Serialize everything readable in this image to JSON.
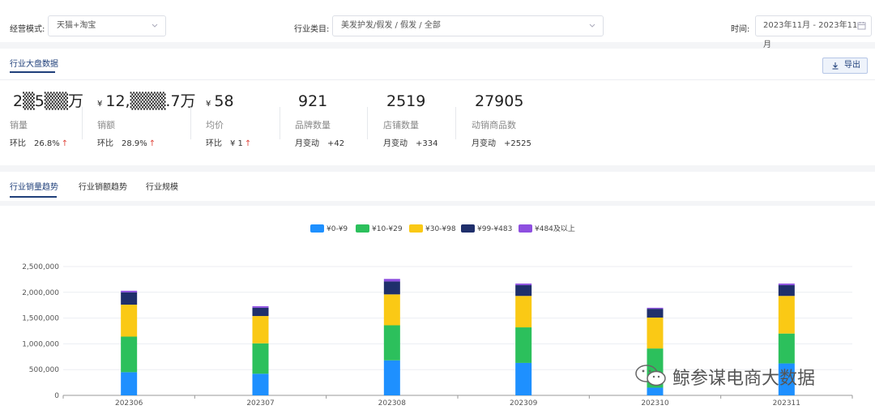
{
  "filters": {
    "mode_label": "经营模式:",
    "mode_value": "天猫+淘宝",
    "category_label": "行业类目:",
    "category_value": "美发护发/假发 / 假发 / 全部",
    "time_label": "时间:",
    "time_value": "2023年11月 - 2023年11月"
  },
  "overview": {
    "tab_label": "行业大盘数据",
    "export_label": "导出",
    "metrics": [
      {
        "currency": "",
        "value": "2▒5▒▒万",
        "label": "销量",
        "change_label": "环比",
        "change_value": "26.8%",
        "arrow": "↑"
      },
      {
        "currency": "¥",
        "value": "12,▒▒▒.7万",
        "label": "销额",
        "change_label": "环比",
        "change_value": "28.9%",
        "arrow": "↑"
      },
      {
        "currency": "¥",
        "value": "58",
        "label": "均价",
        "change_label": "环比",
        "change_value": "¥ 1",
        "arrow": "↑"
      },
      {
        "currency": "",
        "value": "921",
        "label": "品牌数量",
        "change_label": "月变动",
        "change_value": "+42",
        "arrow": ""
      },
      {
        "currency": "",
        "value": "2519",
        "label": "店铺数量",
        "change_label": "月变动",
        "change_value": "+334",
        "arrow": ""
      },
      {
        "currency": "",
        "value": "27905",
        "label": "动销商品数",
        "change_label": "月变动",
        "change_value": "+2525",
        "arrow": ""
      }
    ]
  },
  "trend_tabs": [
    "行业销量趋势",
    "行业销额趋势",
    "行业规模"
  ],
  "chart_data": {
    "type": "bar",
    "stacked": true,
    "categories": [
      "202306",
      "202307",
      "202308",
      "202309",
      "202310",
      "202311"
    ],
    "series": [
      {
        "name": "¥0-¥9",
        "color": "#1e90ff",
        "values": [
          450000,
          420000,
          680000,
          630000,
          150000,
          620000
        ]
      },
      {
        "name": "¥10-¥29",
        "color": "#2cc05c",
        "values": [
          690000,
          590000,
          680000,
          690000,
          760000,
          580000
        ]
      },
      {
        "name": "¥30-¥98",
        "color": "#fac915",
        "values": [
          620000,
          530000,
          600000,
          610000,
          600000,
          730000
        ]
      },
      {
        "name": "¥99-¥483",
        "color": "#1f2f6b",
        "values": [
          240000,
          160000,
          250000,
          210000,
          170000,
          210000
        ]
      },
      {
        "name": "¥484及以上",
        "color": "#8e4fe0",
        "values": [
          30000,
          30000,
          50000,
          30000,
          20000,
          30000
        ]
      }
    ],
    "ylim": [
      0,
      2500000
    ],
    "yticks": [
      0,
      500000,
      1000000,
      1500000,
      2000000,
      2500000
    ],
    "ytick_labels": [
      "0",
      "500,000",
      "1,000,000",
      "1,500,000",
      "2,000,000",
      "2,500,000"
    ],
    "grid": true,
    "legend": "top-center"
  },
  "watermark": {
    "text": "鲸参谋电商大数据"
  }
}
